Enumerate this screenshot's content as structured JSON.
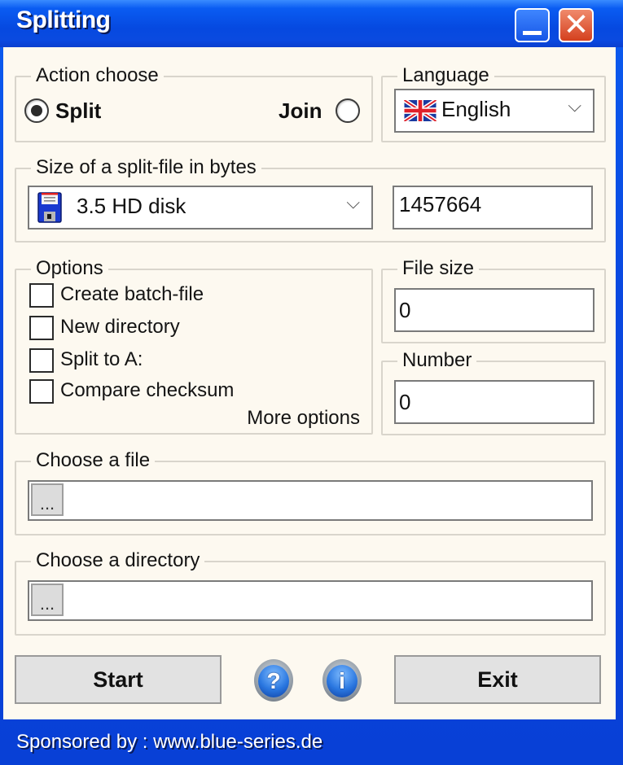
{
  "window": {
    "title": "Splitting",
    "minimize_label": "_",
    "close_label": "✕"
  },
  "action": {
    "legend": "Action choose",
    "split_label": "Split",
    "join_label": "Join",
    "selected": "split"
  },
  "language": {
    "legend": "Language",
    "selected": "English",
    "flag_icon": "uk-flag-icon",
    "chevron": "⌵"
  },
  "size": {
    "legend": "Size of a split-file in bytes",
    "preset_selected": "3.5 HD disk",
    "preset_icon": "floppy-disk-icon",
    "chevron": "⌵",
    "bytes_value": "1457664"
  },
  "options": {
    "legend": "Options",
    "items": [
      {
        "label": "Create batch-file",
        "checked": false
      },
      {
        "label": "New directory",
        "checked": false
      },
      {
        "label": "Split to A:",
        "checked": false
      },
      {
        "label": "Compare checksum",
        "checked": false
      }
    ],
    "more_label": "More options"
  },
  "file_size": {
    "legend": "File size",
    "value": "0"
  },
  "number": {
    "legend": "Number",
    "value": "0"
  },
  "choose_file": {
    "legend": "Choose a file",
    "browse_label": "...",
    "value": ""
  },
  "choose_dir": {
    "legend": "Choose a directory",
    "browse_label": "...",
    "value": ""
  },
  "buttons": {
    "start_label": "Start",
    "help_glyph": "?",
    "info_glyph": "i",
    "exit_label": "Exit"
  },
  "footer": {
    "text": "Sponsored by : www.blue-series.de"
  },
  "colors": {
    "titlebar_blue": "#0a5cf2",
    "client_bg": "#fdf9f0",
    "close_red": "#d4401e"
  }
}
